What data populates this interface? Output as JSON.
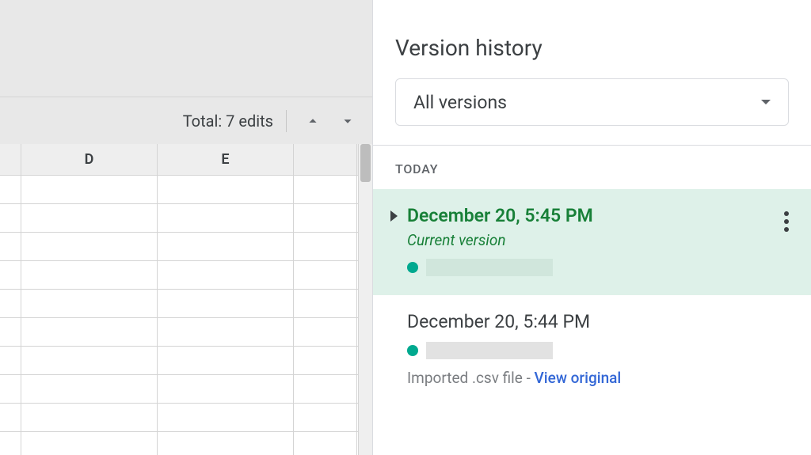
{
  "sheet": {
    "edits_label": "Total: 7 edits",
    "columns": [
      "D",
      "E"
    ]
  },
  "panel": {
    "title": "Version history",
    "dropdown_label": "All versions",
    "section_label": "TODAY",
    "versions": [
      {
        "timestamp": "December 20, 5:45 PM",
        "subtitle": "Current version",
        "author_color": "#00a98f",
        "selected": true
      },
      {
        "timestamp": "December 20, 5:44 PM",
        "author_color": "#00a98f",
        "note_prefix": "Imported .csv file - ",
        "note_link": "View original",
        "selected": false
      }
    ]
  }
}
